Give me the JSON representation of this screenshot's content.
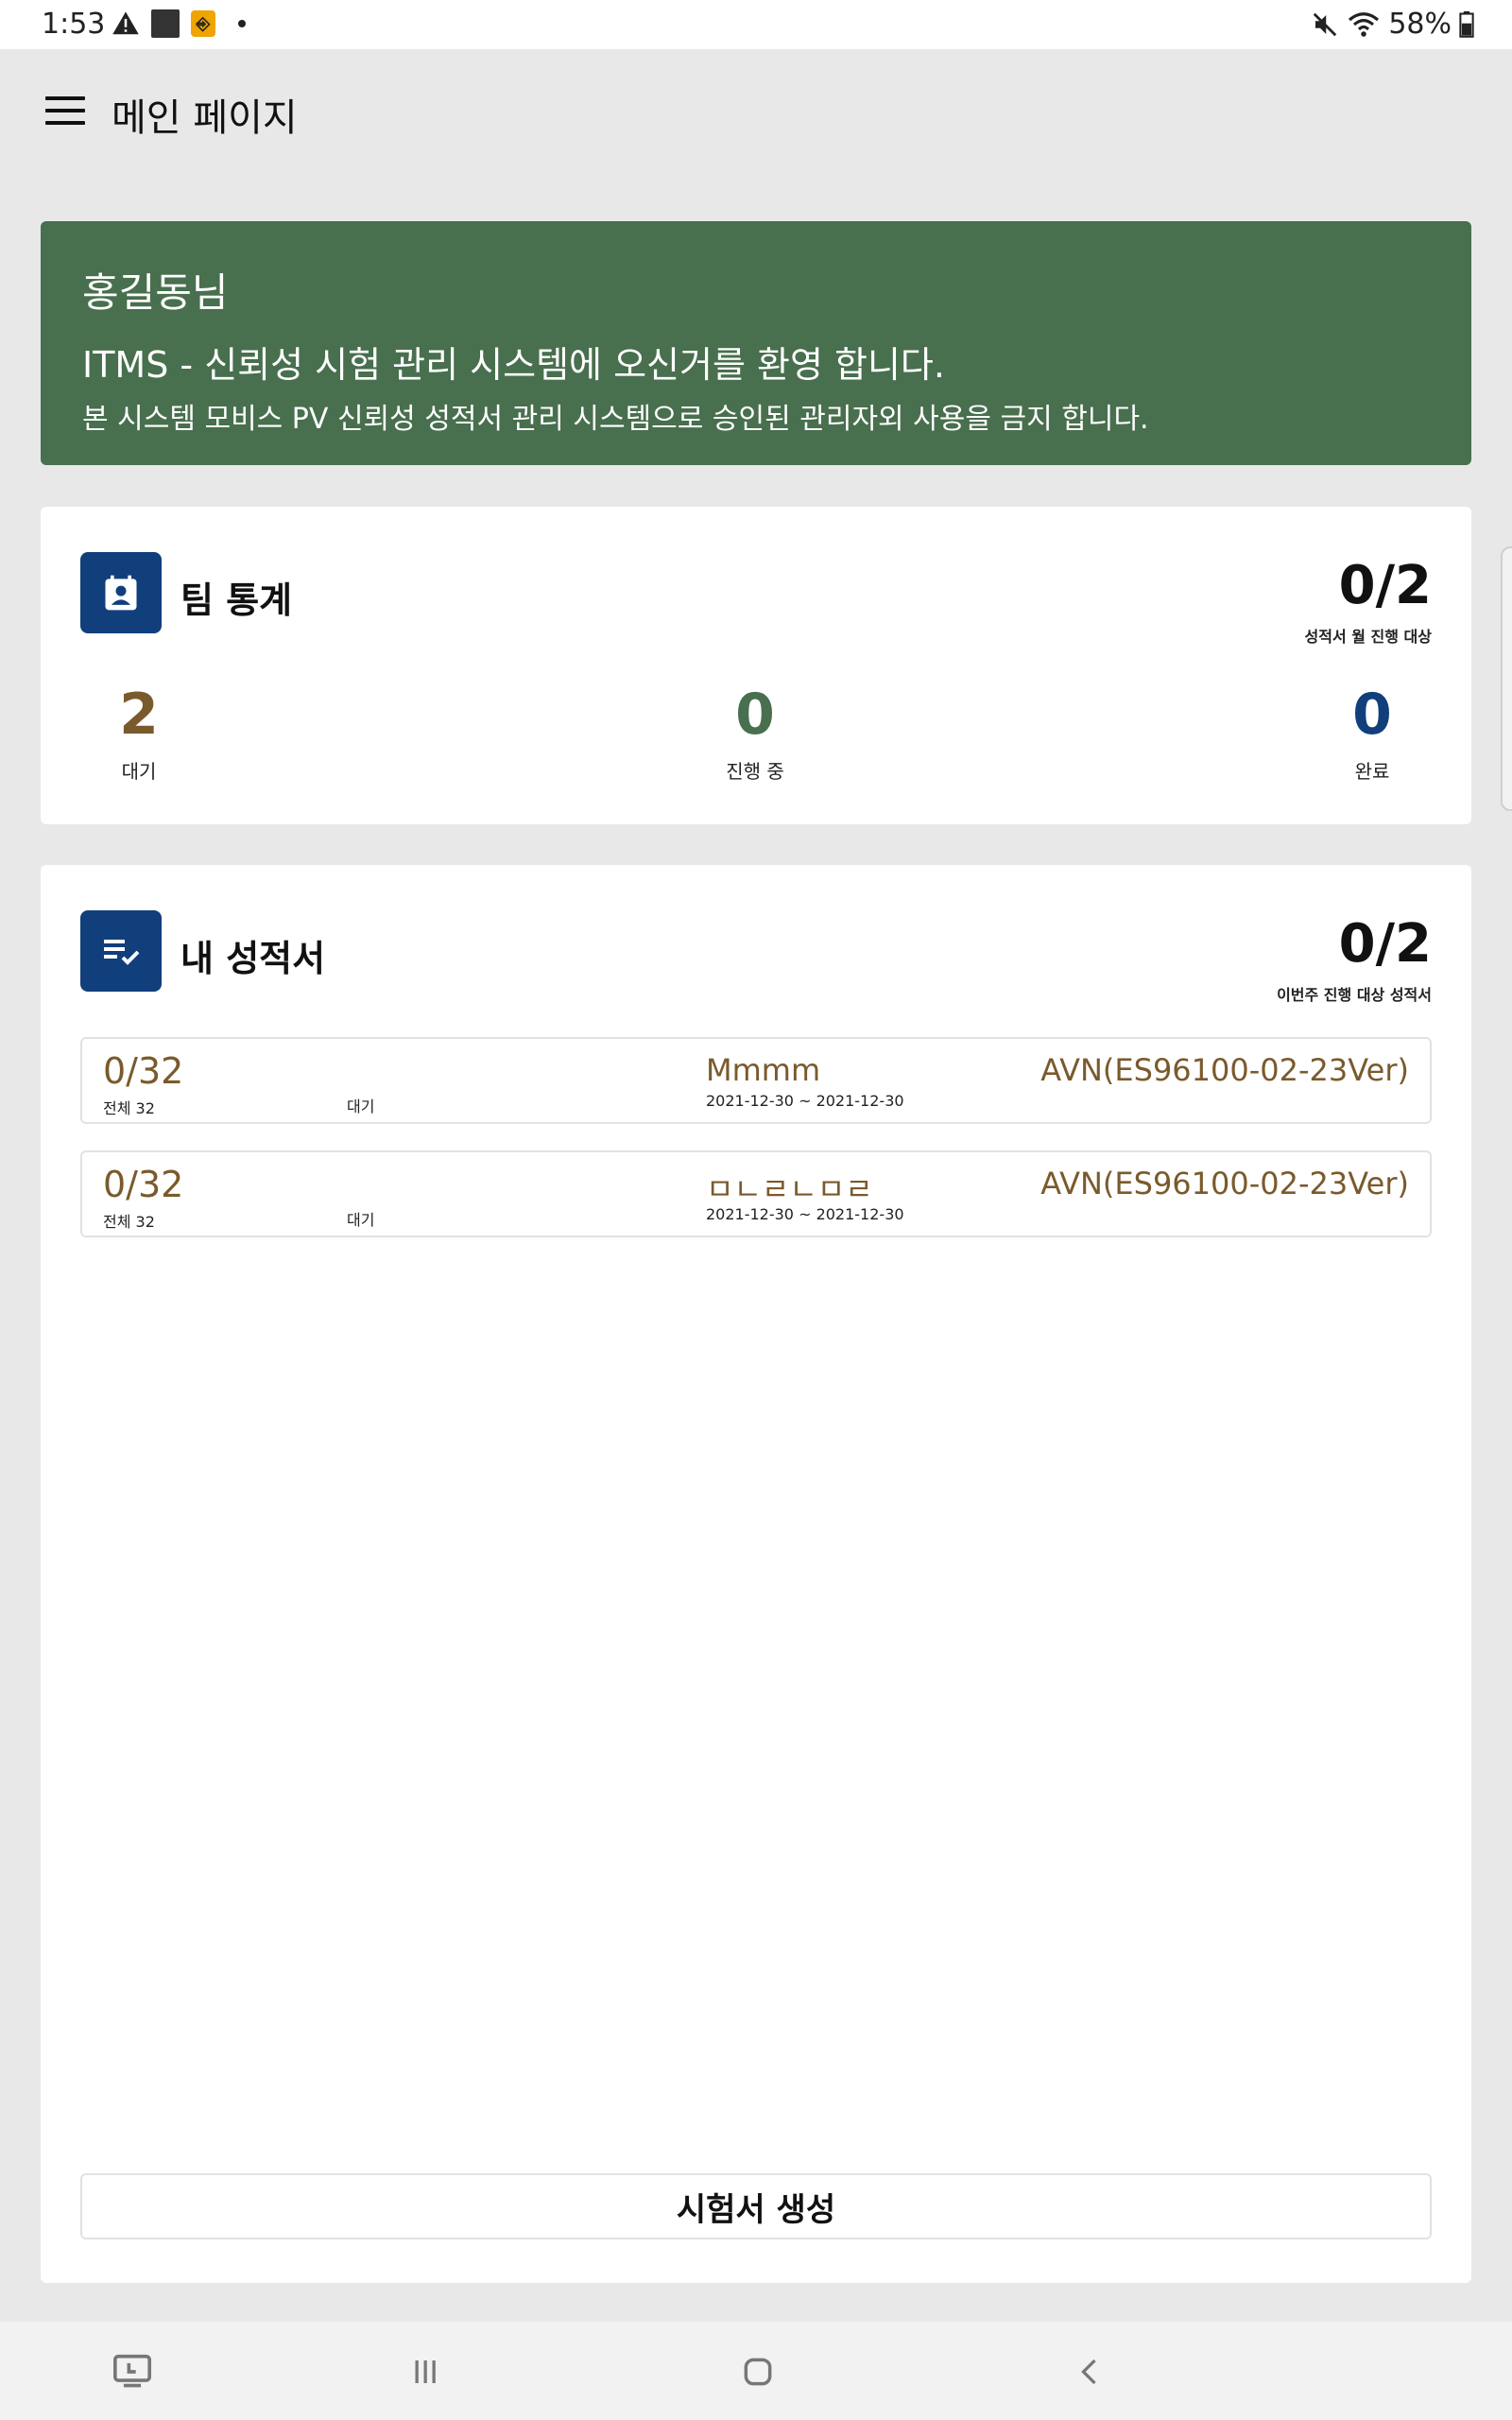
{
  "status_bar": {
    "time": "1:53",
    "battery": "58%"
  },
  "app_bar": {
    "title": "메인 페이지"
  },
  "welcome": {
    "user": "홍길동님",
    "line1": "ITMS - 신뢰성 시험 관리 시스템에 오신거를 환영 합니다.",
    "line2": "본 시스템 모비스 PV 신뢰성 성적서 관리 시스템으로 승인된 관리자외 사용을 금지 합니다.",
    "bg_color": "#486f4e"
  },
  "team_stats": {
    "title": "팀 통계",
    "kpi_value": "0/2",
    "kpi_label": "성적서 월 진행 대상",
    "stats": [
      {
        "value": "2",
        "label": "대기",
        "color": "#7a5a2c"
      },
      {
        "value": "0",
        "label": "진행 중",
        "color": "#486f4e"
      },
      {
        "value": "0",
        "label": "완료",
        "color": "#113f7c"
      }
    ]
  },
  "my_reports": {
    "title": "내 성적서",
    "kpi_value": "0/2",
    "kpi_label": "이번주 진행 대상 성적서",
    "items": [
      {
        "progress": "0/32",
        "total": "전체 32",
        "status": "대기",
        "name": "Mmmm",
        "dates": "2021-12-30 ~ 2021-12-30",
        "model": "AVN(ES96100-02-23Ver)"
      },
      {
        "progress": "0/32",
        "total": "전체 32",
        "status": "대기",
        "name": "ㅁㄴㄹㄴㅁㄹ",
        "dates": "2021-12-30 ~ 2021-12-30",
        "model": "AVN(ES96100-02-23Ver)"
      }
    ],
    "create_button": "시험서 생성"
  },
  "colors": {
    "accent_blue": "#113f7c",
    "brown": "#7a5a2c",
    "green": "#486f4e"
  }
}
